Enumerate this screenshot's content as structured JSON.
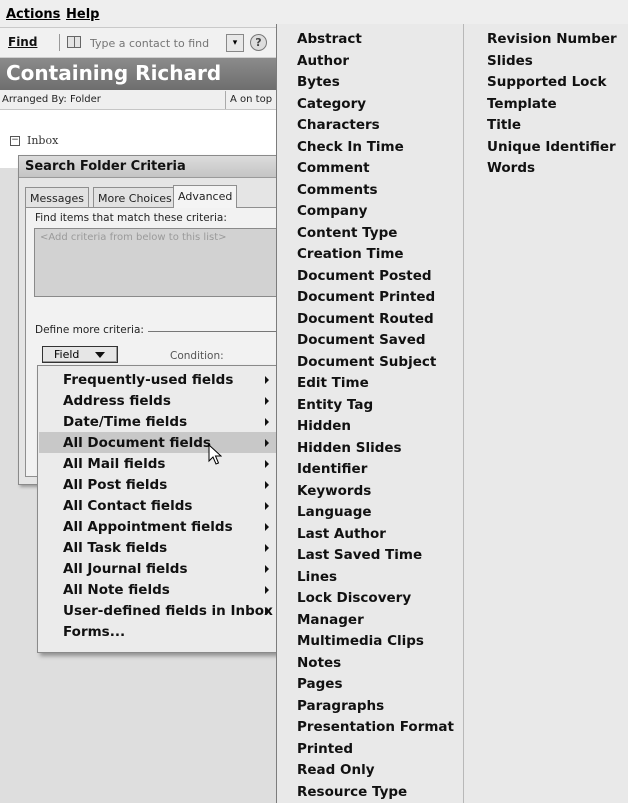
{
  "menubar": {
    "actions": "Actions",
    "help": "Help"
  },
  "findbar": {
    "find_label": "Find",
    "contact_placeholder": "Type a contact to find",
    "dropdown_glyph": "▾",
    "help_glyph": "?"
  },
  "folder": {
    "title": "Containing Richard",
    "arranged_by": "Arranged By: Folder",
    "sort_order": "A on top",
    "inbox_label": "Inbox",
    "collapse_glyph": "−"
  },
  "dialog": {
    "title": "Search Folder Criteria",
    "tabs": [
      "Messages",
      "More Choices",
      "Advanced"
    ],
    "active_tab": "Advanced",
    "find_items_label": "Find items that match these criteria:",
    "criteria_placeholder": "<Add criteria from below to this list>",
    "define_more_label": "Define more criteria:",
    "field_button": "Field",
    "condition_label": "Condition:"
  },
  "field_submenu": {
    "items": [
      "Frequently-used fields",
      "Address fields",
      "Date/Time fields",
      "All Document fields",
      "All Mail fields",
      "All Post fields",
      "All Contact fields",
      "All Appointment fields",
      "All Task fields",
      "All Journal fields",
      "All Note fields",
      "User-defined fields in Inbox",
      "Forms..."
    ],
    "highlighted": "All Document fields"
  },
  "document_fields": {
    "column1": [
      "Abstract",
      "Author",
      "Bytes",
      "Category",
      "Characters",
      "Check In Time",
      "Comment",
      "Comments",
      "Company",
      "Content Type",
      "Creation Time",
      "Document Posted",
      "Document Printed",
      "Document Routed",
      "Document Saved",
      "Document Subject",
      "Edit Time",
      "Entity Tag",
      "Hidden",
      "Hidden Slides",
      "Identifier",
      "Keywords",
      "Language",
      "Last Author",
      "Last Saved Time",
      "Lines",
      "Lock Discovery",
      "Manager",
      "Multimedia Clips",
      "Notes",
      "Pages",
      "Paragraphs",
      "Presentation Format",
      "Printed",
      "Read Only",
      "Resource Type"
    ],
    "column2": [
      "Revision Number",
      "Slides",
      "Supported Lock",
      "Template",
      "Title",
      "Unique Identifier",
      "Words"
    ]
  }
}
